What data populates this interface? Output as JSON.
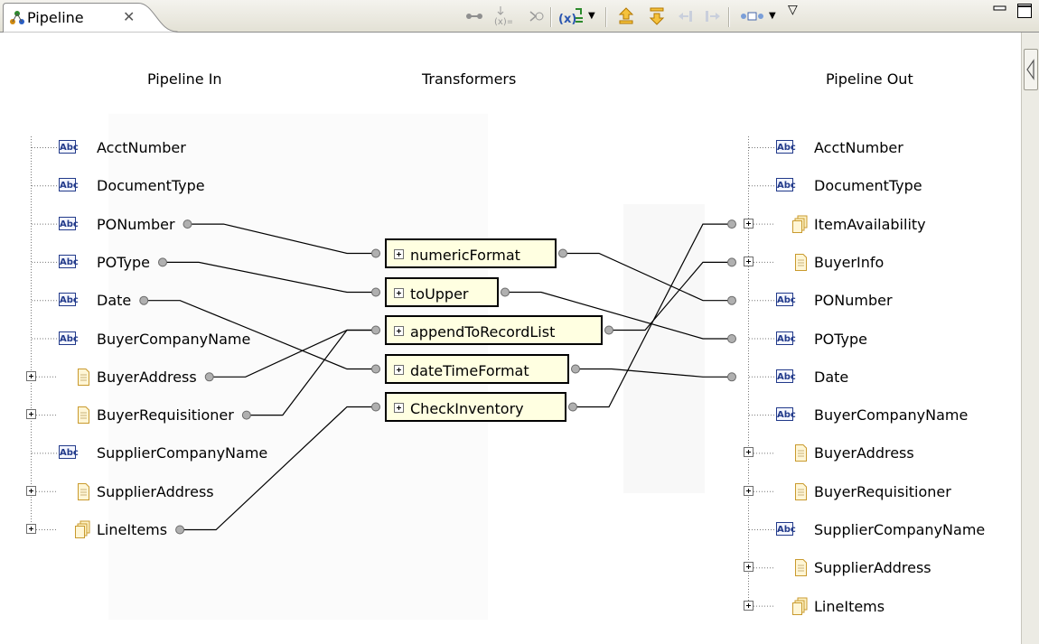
{
  "tab": {
    "title": "Pipeline",
    "close_glyph": "✕"
  },
  "toolbar": {
    "icons": [
      "link-icon",
      "map-drop-icon",
      "map-set-value-icon",
      "insert-transformer-icon",
      "shift-up-icon",
      "shift-down-icon",
      "shift-left-icon",
      "shift-right-icon",
      "layout-icon"
    ],
    "view_menu_glyph": "▽",
    "minimize_glyph": "▭",
    "maximize_glyph": "□"
  },
  "columns": {
    "pipeline_in": "Pipeline In",
    "transformers": "Transformers",
    "pipeline_out": "Pipeline Out"
  },
  "pipeline_in": [
    {
      "label": "AcctNumber",
      "kind": "string"
    },
    {
      "label": "DocumentType",
      "kind": "string"
    },
    {
      "label": "PONumber",
      "kind": "string"
    },
    {
      "label": "POType",
      "kind": "string"
    },
    {
      "label": "Date",
      "kind": "string"
    },
    {
      "label": "BuyerCompanyName",
      "kind": "string"
    },
    {
      "label": "BuyerAddress",
      "kind": "document"
    },
    {
      "label": "BuyerRequisitioner",
      "kind": "document"
    },
    {
      "label": "SupplierCompanyName",
      "kind": "string"
    },
    {
      "label": "SupplierAddress",
      "kind": "document"
    },
    {
      "label": "LineItems",
      "kind": "document-list"
    }
  ],
  "transformers": [
    {
      "label": "numericFormat"
    },
    {
      "label": "toUpper"
    },
    {
      "label": "appendToRecordList"
    },
    {
      "label": "dateTimeFormat"
    },
    {
      "label": "CheckInventory"
    }
  ],
  "pipeline_out": [
    {
      "label": "AcctNumber",
      "kind": "string"
    },
    {
      "label": "DocumentType",
      "kind": "string"
    },
    {
      "label": "ItemAvailability",
      "kind": "document-list"
    },
    {
      "label": "BuyerInfo",
      "kind": "document"
    },
    {
      "label": "PONumber",
      "kind": "string"
    },
    {
      "label": "POType",
      "kind": "string"
    },
    {
      "label": "Date",
      "kind": "string"
    },
    {
      "label": "BuyerCompanyName",
      "kind": "string"
    },
    {
      "label": "BuyerAddress",
      "kind": "document"
    },
    {
      "label": "BuyerRequisitioner",
      "kind": "document"
    },
    {
      "label": "SupplierCompanyName",
      "kind": "string"
    },
    {
      "label": "SupplierAddress",
      "kind": "document"
    },
    {
      "label": "LineItems",
      "kind": "document-list"
    }
  ],
  "string_icon_text": "Abc",
  "links": [
    {
      "from": "in:PONumber",
      "to": "trans:numericFormat"
    },
    {
      "from": "in:POType",
      "to": "trans:toUpper"
    },
    {
      "from": "in:Date",
      "to": "trans:dateTimeFormat"
    },
    {
      "from": "in:BuyerAddress",
      "to": "trans:appendToRecordList"
    },
    {
      "from": "in:BuyerRequisitioner",
      "to": "trans:appendToRecordList"
    },
    {
      "from": "in:LineItems",
      "to": "trans:CheckInventory"
    },
    {
      "from": "trans:numericFormat",
      "to": "out:PONumber"
    },
    {
      "from": "trans:toUpper",
      "to": "out:POType"
    },
    {
      "from": "trans:appendToRecordList",
      "to": "out:BuyerInfo"
    },
    {
      "from": "trans:dateTimeFormat",
      "to": "out:Date"
    },
    {
      "from": "trans:CheckInventory",
      "to": "out:ItemAvailability"
    }
  ],
  "colors": {
    "transformer_fill": "#ffffe1",
    "string_icon": "#223a8a",
    "wire": "#000000"
  }
}
